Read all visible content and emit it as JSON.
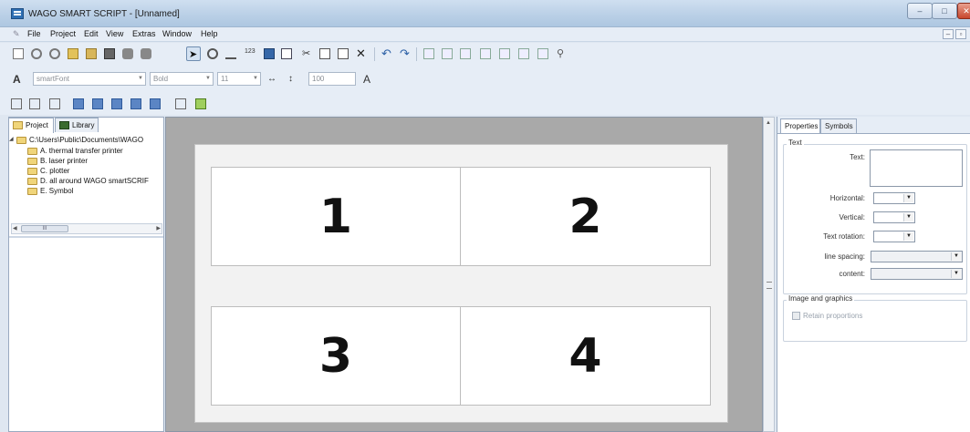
{
  "window": {
    "title": "WAGO SMART SCRIPT - [Unnamed]",
    "controls": [
      "–",
      "□",
      "✕"
    ]
  },
  "menu": {
    "items": [
      "File",
      "Project",
      "Edit",
      "View",
      "Extras",
      "Window",
      "Help"
    ],
    "mdi_controls": [
      "–",
      "▫"
    ]
  },
  "font_toolbar": {
    "font_name": "smartFont",
    "font_style": "Bold",
    "font_size": "11",
    "scale": "100"
  },
  "left_panel": {
    "tabs": [
      "Project",
      "Library"
    ],
    "root_path": "C:\\Users\\Public\\Documents\\WAGO",
    "folders": [
      "A. thermal transfer printer",
      "B. laser printer",
      "C. plotter",
      "D. all around WAGO smartSCRIF",
      "E. Symbol"
    ],
    "scroll_thumb": "III"
  },
  "canvas": {
    "cells": [
      "1",
      "2",
      "3",
      "4"
    ]
  },
  "right_panel": {
    "tabs": [
      "Properties",
      "Symbols"
    ],
    "text_group": "Text",
    "labels": {
      "text": "Text:",
      "horizontal": "Horizontal:",
      "vertical": "Vertical:",
      "text_rotation": "Text rotation:",
      "line_spacing": "line spacing:",
      "content": "content:"
    },
    "image_group": "Image and graphics",
    "retain_proportions": "Retain proportions"
  },
  "colors": {
    "titlebar": "#b9cfe6",
    "toolbar": "#e6edf6",
    "workspace": "#a9a9a9",
    "folder": "#f0d57a"
  }
}
